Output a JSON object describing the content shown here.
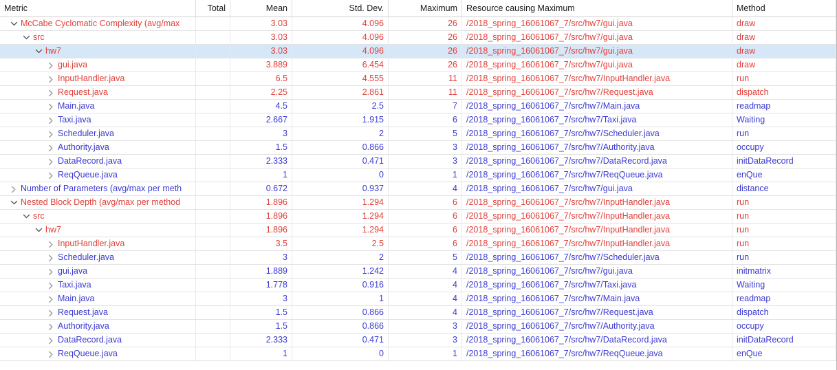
{
  "columns": [
    {
      "key": "metric",
      "label": "Metric"
    },
    {
      "key": "total",
      "label": "Total"
    },
    {
      "key": "mean",
      "label": "Mean"
    },
    {
      "key": "std",
      "label": "Std. Dev."
    },
    {
      "key": "max",
      "label": "Maximum"
    },
    {
      "key": "res",
      "label": "Resource causing Maximum"
    },
    {
      "key": "method",
      "label": "Method"
    }
  ],
  "colors": {
    "red": "#e0403a",
    "blue": "#3a3ad1",
    "selection": "#d6e7f7",
    "header_text": "#1a1a1a",
    "grid": "#e3e3e3"
  },
  "icons": {
    "expanded": "chevron-down-icon",
    "collapsed": "chevron-right-icon"
  },
  "rows": [
    {
      "indent": 0,
      "state": "expanded",
      "label": "McCabe Cyclomatic Complexity (avg/max",
      "color": "red",
      "total": "",
      "mean": "3.03",
      "std": "4.096",
      "max": "26",
      "res": "/2018_spring_16061067_7/src/hw7/gui.java",
      "method": "draw",
      "selected": false
    },
    {
      "indent": 1,
      "state": "expanded",
      "label": "src",
      "color": "red",
      "total": "",
      "mean": "3.03",
      "std": "4.096",
      "max": "26",
      "res": "/2018_spring_16061067_7/src/hw7/gui.java",
      "method": "draw",
      "selected": false
    },
    {
      "indent": 2,
      "state": "expanded",
      "label": "hw7",
      "color": "red",
      "total": "",
      "mean": "3.03",
      "std": "4.096",
      "max": "26",
      "res": "/2018_spring_16061067_7/src/hw7/gui.java",
      "method": "draw",
      "selected": true
    },
    {
      "indent": 3,
      "state": "collapsed",
      "label": "gui.java",
      "color": "red",
      "total": "",
      "mean": "3.889",
      "std": "6.454",
      "max": "26",
      "res": "/2018_spring_16061067_7/src/hw7/gui.java",
      "method": "draw",
      "selected": false
    },
    {
      "indent": 3,
      "state": "collapsed",
      "label": "InputHandler.java",
      "color": "red",
      "total": "",
      "mean": "6.5",
      "std": "4.555",
      "max": "11",
      "res": "/2018_spring_16061067_7/src/hw7/InputHandler.java",
      "method": "run",
      "selected": false
    },
    {
      "indent": 3,
      "state": "collapsed",
      "label": "Request.java",
      "color": "red",
      "total": "",
      "mean": "2.25",
      "std": "2.861",
      "max": "11",
      "res": "/2018_spring_16061067_7/src/hw7/Request.java",
      "method": "dispatch",
      "selected": false
    },
    {
      "indent": 3,
      "state": "collapsed",
      "label": "Main.java",
      "color": "blue",
      "total": "",
      "mean": "4.5",
      "std": "2.5",
      "max": "7",
      "res": "/2018_spring_16061067_7/src/hw7/Main.java",
      "method": "readmap",
      "selected": false
    },
    {
      "indent": 3,
      "state": "collapsed",
      "label": "Taxi.java",
      "color": "blue",
      "total": "",
      "mean": "2.667",
      "std": "1.915",
      "max": "6",
      "res": "/2018_spring_16061067_7/src/hw7/Taxi.java",
      "method": "Waiting",
      "selected": false
    },
    {
      "indent": 3,
      "state": "collapsed",
      "label": "Scheduler.java",
      "color": "blue",
      "total": "",
      "mean": "3",
      "std": "2",
      "max": "5",
      "res": "/2018_spring_16061067_7/src/hw7/Scheduler.java",
      "method": "run",
      "selected": false
    },
    {
      "indent": 3,
      "state": "collapsed",
      "label": "Authority.java",
      "color": "blue",
      "total": "",
      "mean": "1.5",
      "std": "0.866",
      "max": "3",
      "res": "/2018_spring_16061067_7/src/hw7/Authority.java",
      "method": "occupy",
      "selected": false
    },
    {
      "indent": 3,
      "state": "collapsed",
      "label": "DataRecord.java",
      "color": "blue",
      "total": "",
      "mean": "2.333",
      "std": "0.471",
      "max": "3",
      "res": "/2018_spring_16061067_7/src/hw7/DataRecord.java",
      "method": "initDataRecord",
      "selected": false
    },
    {
      "indent": 3,
      "state": "collapsed",
      "label": "ReqQueue.java",
      "color": "blue",
      "total": "",
      "mean": "1",
      "std": "0",
      "max": "1",
      "res": "/2018_spring_16061067_7/src/hw7/ReqQueue.java",
      "method": "enQue",
      "selected": false
    },
    {
      "indent": 0,
      "state": "collapsed",
      "label": "Number of Parameters (avg/max per meth",
      "color": "blue",
      "total": "",
      "mean": "0.672",
      "std": "0.937",
      "max": "4",
      "res": "/2018_spring_16061067_7/src/hw7/gui.java",
      "method": "distance",
      "selected": false
    },
    {
      "indent": 0,
      "state": "expanded",
      "label": "Nested Block Depth (avg/max per method",
      "color": "red",
      "total": "",
      "mean": "1.896",
      "std": "1.294",
      "max": "6",
      "res": "/2018_spring_16061067_7/src/hw7/InputHandler.java",
      "method": "run",
      "selected": false
    },
    {
      "indent": 1,
      "state": "expanded",
      "label": "src",
      "color": "red",
      "total": "",
      "mean": "1.896",
      "std": "1.294",
      "max": "6",
      "res": "/2018_spring_16061067_7/src/hw7/InputHandler.java",
      "method": "run",
      "selected": false
    },
    {
      "indent": 2,
      "state": "expanded",
      "label": "hw7",
      "color": "red",
      "total": "",
      "mean": "1.896",
      "std": "1.294",
      "max": "6",
      "res": "/2018_spring_16061067_7/src/hw7/InputHandler.java",
      "method": "run",
      "selected": false
    },
    {
      "indent": 3,
      "state": "collapsed",
      "label": "InputHandler.java",
      "color": "red",
      "total": "",
      "mean": "3.5",
      "std": "2.5",
      "max": "6",
      "res": "/2018_spring_16061067_7/src/hw7/InputHandler.java",
      "method": "run",
      "selected": false
    },
    {
      "indent": 3,
      "state": "collapsed",
      "label": "Scheduler.java",
      "color": "blue",
      "total": "",
      "mean": "3",
      "std": "2",
      "max": "5",
      "res": "/2018_spring_16061067_7/src/hw7/Scheduler.java",
      "method": "run",
      "selected": false
    },
    {
      "indent": 3,
      "state": "collapsed",
      "label": "gui.java",
      "color": "blue",
      "total": "",
      "mean": "1.889",
      "std": "1.242",
      "max": "4",
      "res": "/2018_spring_16061067_7/src/hw7/gui.java",
      "method": "initmatrix",
      "selected": false
    },
    {
      "indent": 3,
      "state": "collapsed",
      "label": "Taxi.java",
      "color": "blue",
      "total": "",
      "mean": "1.778",
      "std": "0.916",
      "max": "4",
      "res": "/2018_spring_16061067_7/src/hw7/Taxi.java",
      "method": "Waiting",
      "selected": false
    },
    {
      "indent": 3,
      "state": "collapsed",
      "label": "Main.java",
      "color": "blue",
      "total": "",
      "mean": "3",
      "std": "1",
      "max": "4",
      "res": "/2018_spring_16061067_7/src/hw7/Main.java",
      "method": "readmap",
      "selected": false
    },
    {
      "indent": 3,
      "state": "collapsed",
      "label": "Request.java",
      "color": "blue",
      "total": "",
      "mean": "1.5",
      "std": "0.866",
      "max": "4",
      "res": "/2018_spring_16061067_7/src/hw7/Request.java",
      "method": "dispatch",
      "selected": false
    },
    {
      "indent": 3,
      "state": "collapsed",
      "label": "Authority.java",
      "color": "blue",
      "total": "",
      "mean": "1.5",
      "std": "0.866",
      "max": "3",
      "res": "/2018_spring_16061067_7/src/hw7/Authority.java",
      "method": "occupy",
      "selected": false
    },
    {
      "indent": 3,
      "state": "collapsed",
      "label": "DataRecord.java",
      "color": "blue",
      "total": "",
      "mean": "2.333",
      "std": "0.471",
      "max": "3",
      "res": "/2018_spring_16061067_7/src/hw7/DataRecord.java",
      "method": "initDataRecord",
      "selected": false
    },
    {
      "indent": 3,
      "state": "collapsed",
      "label": "ReqQueue.java",
      "color": "blue",
      "total": "",
      "mean": "1",
      "std": "0",
      "max": "1",
      "res": "/2018_spring_16061067_7/src/hw7/ReqQueue.java",
      "method": "enQue",
      "selected": false
    }
  ]
}
